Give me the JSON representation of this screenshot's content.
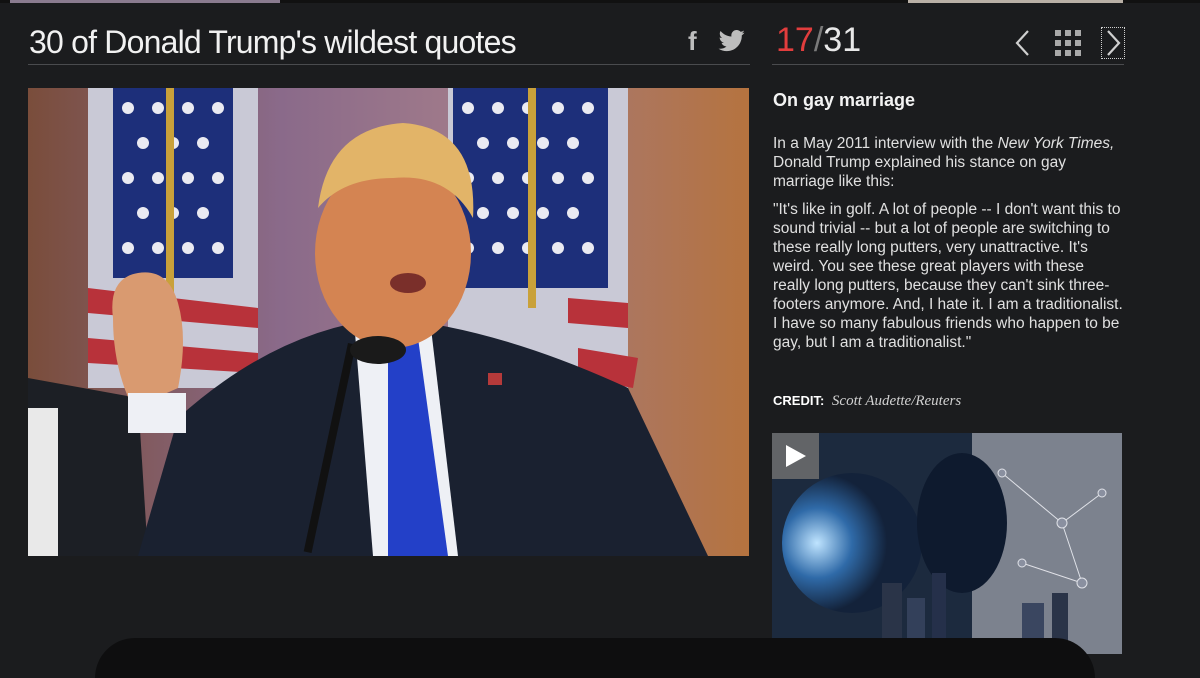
{
  "gallery": {
    "title": "30 of Donald Trump's wildest quotes",
    "current": "17",
    "separator": "/",
    "total": "31"
  },
  "share": {
    "facebook_glyph": "f",
    "icons": [
      "facebook-icon",
      "twitter-icon"
    ]
  },
  "nav": {
    "icons": [
      "chevron-left-icon",
      "grid-icon",
      "chevron-right-icon"
    ]
  },
  "slide": {
    "heading": "On gay marriage",
    "intro_before": "In a May 2011 interview with the ",
    "intro_source": "New York Times,",
    "intro_after": " Donald Trump explained his stance on gay marriage like this:",
    "quote": "\"It's like in golf. A lot of people -- I don't want this to sound trivial -- but a lot of people are switching to these really long putters, very unattractive. It's weird. You see these great players with these really long putters, because they can't sink three-footers anymore. And, I hate it. I am a traditionalist. I have so many fabulous friends who happen to be gay, but I am a traditionalist.\"",
    "credit_label": "CREDIT:",
    "credit_value": "Scott Audette/Reuters"
  },
  "ad": {
    "icon": "play-icon"
  },
  "colors": {
    "background": "#1b1c1e",
    "accent_red": "#e23d3d",
    "tie_blue": "#2340c8",
    "suit": "#1a2130"
  }
}
